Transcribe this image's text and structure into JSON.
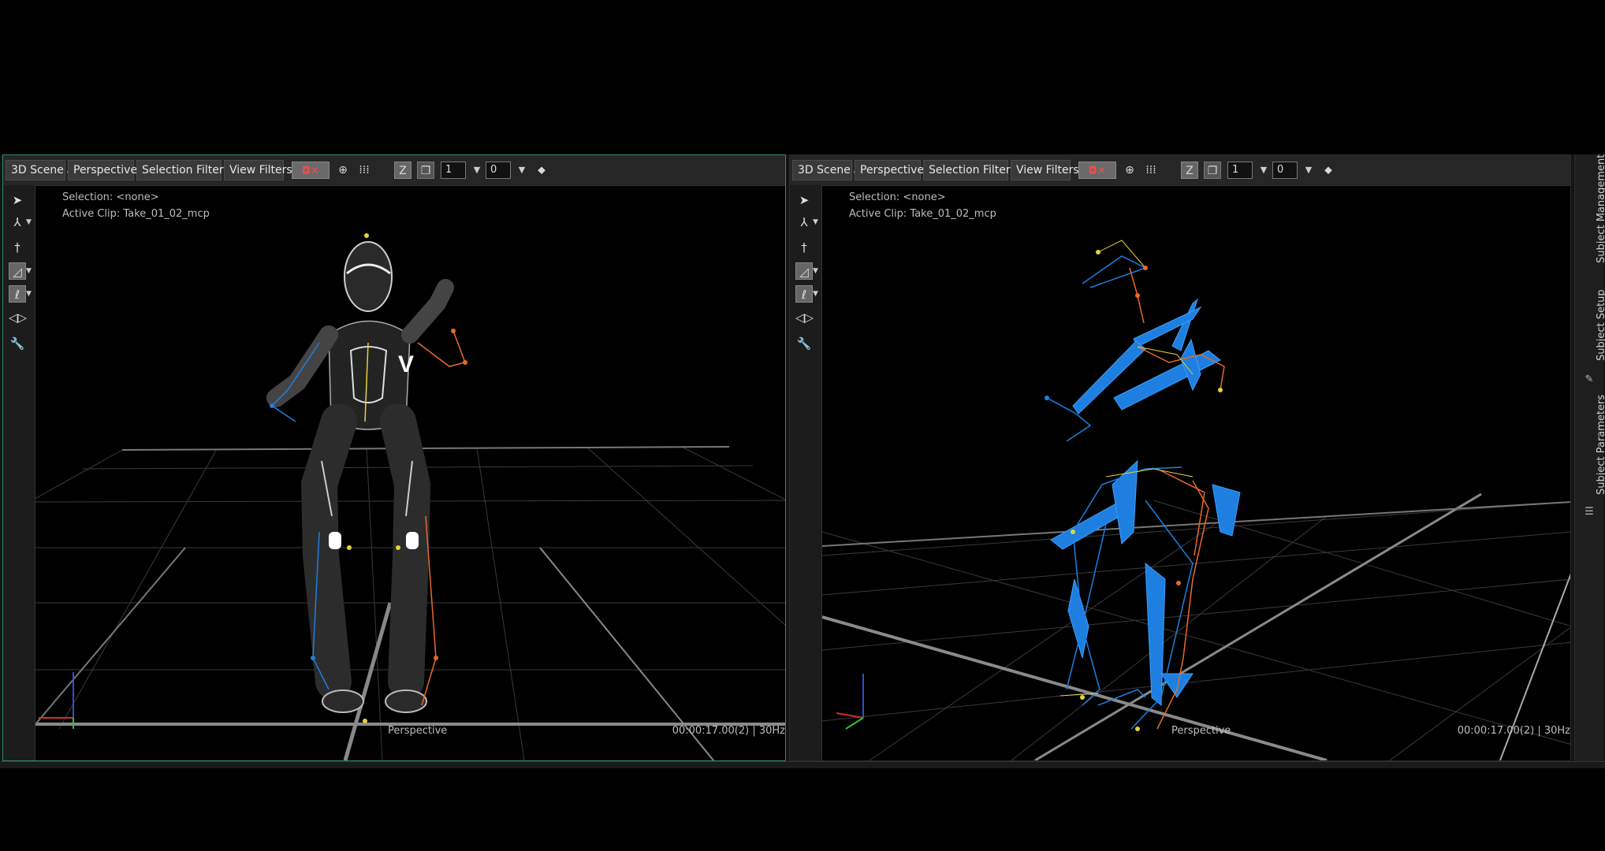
{
  "viewports": [
    {
      "toolbar": {
        "scene_label": "3D Scene",
        "camera_label": "Perspective",
        "selection_filters_label": "Selection Filters",
        "view_filters_label": "View Filters",
        "field_a": "1",
        "field_b": "0"
      },
      "selection_text": "Selection: <none>",
      "active_clip_text": "Active Clip: Take_01_02_mcp",
      "camera_name": "Perspective",
      "timecode": "00:00:17.00(2) | 30Hz"
    },
    {
      "toolbar": {
        "scene_label": "3D Scene",
        "camera_label": "Perspective",
        "selection_filters_label": "Selection Filters",
        "view_filters_label": "View Filters",
        "field_a": "1",
        "field_b": "0"
      },
      "selection_text": "Selection: <none>",
      "active_clip_text": "Active Clip: Take_01_02_mcp",
      "camera_name": "Perspective",
      "timecode": "00:00:17.00(2) | 30Hz"
    }
  ],
  "right_panel": {
    "tabs": [
      "Subject Management",
      "Subject Setup",
      "Subject Parameters"
    ]
  },
  "colors": {
    "accent_border": "#2f8a6a",
    "bone_blue": "#1e7fe0",
    "marker_orange": "#e8692a",
    "marker_yellow": "#e6d23a",
    "grid": "#3a3a3a"
  },
  "icons": {
    "toolbar": [
      "camera-record-icon",
      "eye-plus-icon",
      "grid-dots-icon",
      "sort-z-icon",
      "layers-icon",
      "pin-icon"
    ],
    "sidebar": [
      "select-arrow-icon",
      "axis-gizmo-icon",
      "stick-figure-icon",
      "shape-tool-icon",
      "light-tool-icon",
      "playback-icon",
      "wrench-icon"
    ]
  }
}
